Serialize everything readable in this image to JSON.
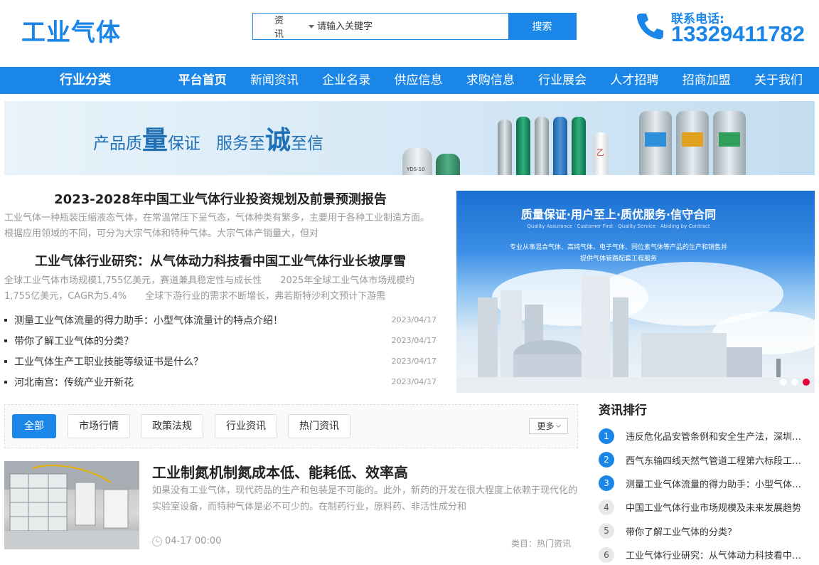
{
  "header": {
    "logo": "工业气体",
    "search_category": "资讯",
    "search_placeholder": "请输入关键字",
    "search_button": "搜索",
    "phone_label": "联系电话:",
    "phone_number": "13329411782"
  },
  "nav": {
    "category": "行业分类",
    "items": [
      "平台首页",
      "新闻资讯",
      "企业名录",
      "供应信息",
      "求购信息",
      "行业展会",
      "人才招聘",
      "招商加盟",
      "关于我们"
    ]
  },
  "banner": {
    "part1": "产品质",
    "big1": "量",
    "part2": "保证",
    "part3": "服务至",
    "big2": "诚",
    "part4": "至信",
    "cylinder_labels": [
      "乙"
    ],
    "small_tank_label": "YDS-10"
  },
  "featured": [
    {
      "title": "2023-2028年中国工业气体行业投资规划及前景预测报告",
      "summary": "工业气体一种瓶装压缩液态气体，在常温常压下呈气态，气体种类有繁多，主要用于各种工业制造方面。根据应用领域的不同，可分为大宗气体和特种气体。大宗气体产销量大，但对"
    },
    {
      "title": "工业气体行业研究：从气体动力科技看中国工业气体行业长坡厚雪",
      "summary": "全球工业气体市场规模1,755亿美元，赛道兼具稳定性与成长性　　2025年全球工业气体市场规模约1,755亿美元，CAGR为5.4%　　全球下游行业的需求不断增长，弗若斯特沙利文预计下游需"
    }
  ],
  "news_list": [
    {
      "title": "测量工业气体流量的得力助手：小型气体流量计的特点介绍！",
      "date": "2023/04/17"
    },
    {
      "title": "带你了解工业气体的分类？",
      "date": "2023/04/17"
    },
    {
      "title": "工业气体生产工职业技能等级证书是什么？",
      "date": "2023/04/17"
    },
    {
      "title": "河北南宫：传统产业开新花",
      "date": "2023/04/17"
    }
  ],
  "photo": {
    "title": "质量保证·用户至上·质优服务·信守合同",
    "subtitle_en": "Quality Assurance · Customer First · Quality Service · Abiding by Contract",
    "desc1": "专业从事混合气体、高纯气体、电子气体、同位素气体等产品的生产和销售并",
    "desc2": "提供气体管路配套工程服务"
  },
  "tabs": {
    "items": [
      "全部",
      "市场行情",
      "政策法规",
      "行业资讯",
      "热门资讯"
    ],
    "more": "更多"
  },
  "article": {
    "title": "工业制氮机制氮成本低、能耗低、效率高",
    "summary": "如果没有工业气体，现代药品的生产和包装是不可能的。此外，新药的开发在很大程度上依赖于现代化的实验室设备，而特种气体是必不可少的。在制药行业，原料药、非活性成分和",
    "time": "04-17 00:00",
    "category": "类目：热门资讯"
  },
  "ranking": {
    "title": "资讯排行",
    "items": [
      "违反危化品安管条例和安全生产法，深圳…",
      "西气东输四线天然气管道工程第六标段工…",
      "测量工业气体流量的得力助手：小型气体…",
      "中国工业气体行业市场规模及未来发展趋势",
      "带你了解工业气体的分类？",
      "工业气体行业研究：从气体动力科技看中…"
    ]
  },
  "colors": {
    "accent": "#1a86e8",
    "slider_active": "#e4003a"
  }
}
